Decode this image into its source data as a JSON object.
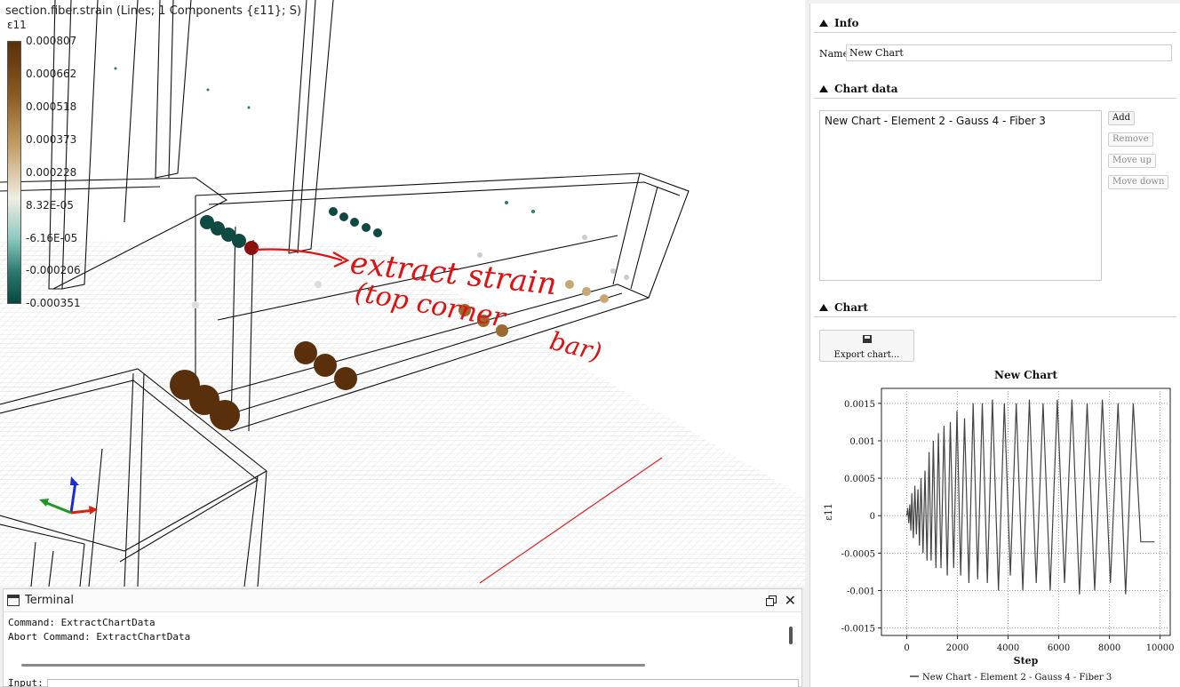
{
  "viewport": {
    "title": "section.fiber.strain (Lines; 1 Components {ε11}; S)",
    "legend": {
      "component": "ε11",
      "ticks": [
        "0.000807",
        "0.000662",
        "0.000518",
        "0.000373",
        "0.000228",
        "8.32E-05",
        "-6.16E-05",
        "-0.000206",
        "-0.000351"
      ]
    },
    "annotation": [
      "extract strain",
      "(top corner",
      "bar)"
    ],
    "axes_icon": "xyz-axes-icon"
  },
  "terminal": {
    "title": "Terminal",
    "lines": [
      "Command: ExtractChartData",
      "Abort Command: ExtractChartData"
    ],
    "input_label": "Input:"
  },
  "panel": {
    "info": {
      "header": "Info",
      "name_label": "Name",
      "name_value": "New Chart"
    },
    "chart_data": {
      "header": "Chart data",
      "items": [
        "New Chart - Element 2 - Gauss 4 - Fiber 3"
      ],
      "buttons": {
        "add": "Add",
        "remove": "Remove",
        "move_up": "Move up",
        "move_down": "Move down"
      }
    },
    "chart": {
      "header": "Chart",
      "export_label": "Export chart..."
    }
  },
  "chart_data": {
    "type": "line",
    "title": "New Chart",
    "xlabel": "Step",
    "ylabel": "ε11",
    "xlim": [
      -1000,
      10400
    ],
    "ylim": [
      -0.0016,
      0.0017
    ],
    "xticks": [
      0,
      2000,
      4000,
      6000,
      8000,
      10000
    ],
    "xtick_labels": [
      "0",
      "2000",
      "4000",
      "6000",
      "8000",
      "10000"
    ],
    "yticks": [
      0.0015,
      0.001,
      0.0005,
      0,
      -0.0005,
      -0.001,
      -0.0015
    ],
    "ytick_labels": [
      "0.0015",
      "0.001",
      "0.0005",
      "0",
      "-0.0005",
      "-0.001",
      "-0.0015"
    ],
    "grid": true,
    "legend": "bottom",
    "series": [
      {
        "name": "New Chart - Element 2 - Gauss 4 - Fiber 3",
        "color": "#444444",
        "x": [
          0,
          40,
          80,
          120,
          160,
          200,
          260,
          320,
          380,
          440,
          500,
          560,
          640,
          720,
          800,
          880,
          960,
          1050,
          1150,
          1250,
          1350,
          1470,
          1600,
          1720,
          1850,
          1980,
          2130,
          2280,
          2450,
          2620,
          2800,
          2980,
          3180,
          3380,
          3620,
          3850,
          4090,
          4320,
          4580,
          4840,
          5110,
          5380,
          5660,
          5940,
          6230,
          6520,
          6820,
          7120,
          7420,
          7720,
          8040,
          8340,
          8640,
          8940,
          9240,
          9520,
          9780
        ],
        "y": [
          0,
          0.0001,
          -0.0001,
          0.00015,
          -0.0002,
          0.0003,
          -0.0003,
          0.0004,
          -0.00025,
          0.00035,
          -0.0004,
          0.0005,
          -0.0005,
          0.0006,
          -0.0006,
          0.00085,
          -0.0006,
          0.001,
          -0.0007,
          0.0011,
          -0.0007,
          0.0012,
          -0.0008,
          0.00125,
          -0.0007,
          0.0014,
          -0.0008,
          0.0013,
          -0.0009,
          0.0015,
          -0.00085,
          0.0015,
          -0.0009,
          0.00155,
          -0.001,
          0.0015,
          -0.0008,
          0.0015,
          -0.001,
          0.00155,
          -0.0009,
          0.0015,
          -0.001,
          0.00155,
          -0.0009,
          0.00155,
          -0.00105,
          0.0015,
          -0.001,
          0.00155,
          -0.0009,
          0.0015,
          -0.00105,
          0.0015,
          -0.00035,
          -0.00035,
          -0.00035
        ]
      }
    ]
  }
}
